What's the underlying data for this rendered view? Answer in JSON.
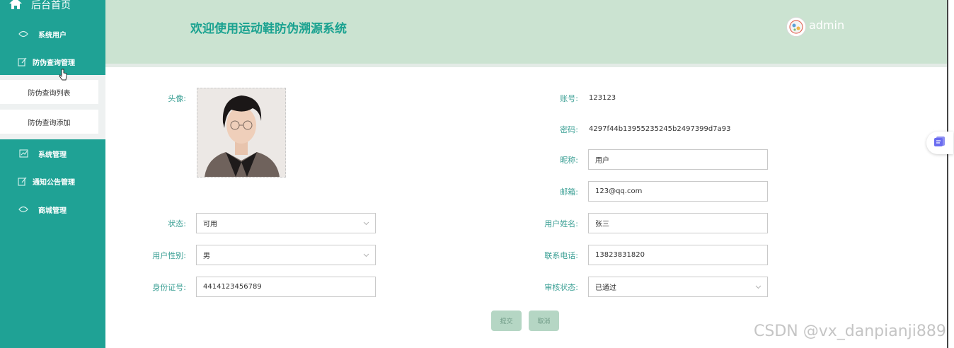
{
  "sidebar": {
    "home_label": "后台首页",
    "menu": [
      {
        "label": "系统用户",
        "icon": "user-icon"
      },
      {
        "label": "防伪查询管理",
        "icon": "edit-icon"
      },
      {
        "label": "系统管理",
        "icon": "chart-icon"
      },
      {
        "label": "通知公告管理",
        "icon": "edit-icon"
      },
      {
        "label": "商城管理",
        "icon": "user-icon"
      }
    ],
    "submenu": [
      {
        "label": "防伪查询列表"
      },
      {
        "label": "防伪查询添加"
      }
    ]
  },
  "header": {
    "title": "欢迎使用运动鞋防伪溯源系统",
    "username": "admin"
  },
  "form": {
    "avatar_label": "头像:",
    "account_label": "账号:",
    "account_value": "123123",
    "password_label": "密码:",
    "password_value": "4297f44b13955235245b2497399d7a93",
    "nickname_label": "昵称:",
    "nickname_value": "用户",
    "email_label": "邮箱:",
    "email_value": "123@qq.com",
    "status_label": "状态:",
    "status_value": "可用",
    "realname_label": "用户姓名:",
    "realname_value": "张三",
    "gender_label": "用户性别:",
    "gender_value": "男",
    "phone_label": "联系电话:",
    "phone_value": "13823831820",
    "idcard_label": "身份证号:",
    "idcard_value": "4414123456789",
    "audit_label": "审核状态:",
    "audit_value": "已通过",
    "submit_label": "提交",
    "cancel_label": "取消"
  },
  "watermark": "CSDN @vx_danpianji889",
  "colors": {
    "sidebar": "#1fa295",
    "header": "#cbe3d1",
    "accent": "#1aa290",
    "label": "#3a9f94",
    "button": "#b5d6c4"
  }
}
